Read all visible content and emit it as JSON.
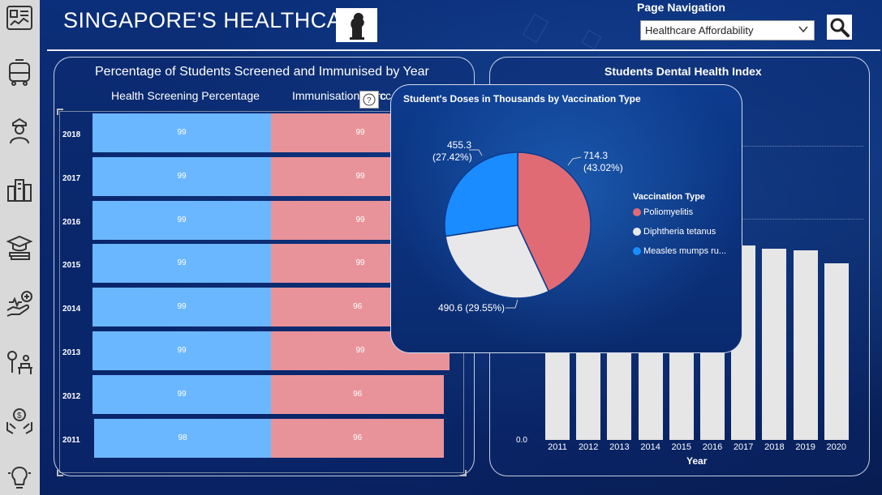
{
  "header": {
    "title": "SINGAPORE'S HEALTHCARE",
    "logo_icon": "merlion-icon"
  },
  "navigation": {
    "label": "Page Navigation",
    "selected": "Healthcare Affordability",
    "search_icon": "search-icon"
  },
  "sidebar": {
    "items": [
      {
        "icon": "dashboard-icon"
      },
      {
        "icon": "bus-icon"
      },
      {
        "icon": "officer-icon"
      },
      {
        "icon": "city-icon"
      },
      {
        "icon": "education-icon"
      },
      {
        "icon": "healthcare-hand-icon"
      },
      {
        "icon": "park-bench-icon"
      },
      {
        "icon": "money-hands-icon"
      },
      {
        "icon": "lightbulb-icon"
      }
    ]
  },
  "left_panel": {
    "title": "Percentage of Students Screened and Immunised by Year",
    "col1": "Health Screening Percentage",
    "col2": "Immunisation Perc",
    "col2_tail": "cc",
    "help_icon": "?"
  },
  "right_panel": {
    "title": "Students Dental Health Index",
    "xlabel": "Year",
    "y_zero": "0.0"
  },
  "popup": {
    "title": "Student's Doses in Thousands by Vaccination Type",
    "legend_title": "Vaccination Type",
    "labels": {
      "measles_value": "455.3",
      "measles_pct": "(27.42%)",
      "polio_value": "714.3",
      "polio_pct": "(43.02%)",
      "diph_label": "490.6 (29.55%)"
    }
  },
  "chart_data": [
    {
      "type": "bar",
      "title": "Percentage of Students Screened and Immunised by Year",
      "categories": [
        "2018",
        "2017",
        "2016",
        "2015",
        "2014",
        "2013",
        "2012",
        "2011"
      ],
      "series": [
        {
          "name": "Health Screening Percentage",
          "values": [
            99,
            99,
            99,
            99,
            99,
            99,
            99,
            98
          ],
          "color": "#6bb7ff"
        },
        {
          "name": "Immunisation Percentage",
          "values": [
            99,
            99,
            99,
            99,
            96,
            99,
            96,
            96
          ],
          "color": "#e8939a"
        }
      ]
    },
    {
      "type": "pie",
      "title": "Student's Doses in Thousands by Vaccination Type",
      "slices": [
        {
          "name": "Poliomyelitis",
          "value": 714.3,
          "percent": 43.02,
          "color": "#e06b75"
        },
        {
          "name": "Diphtheria tetanus",
          "value": 490.6,
          "percent": 29.55,
          "color": "#e8e8ea"
        },
        {
          "name": "Measles mumps ru...",
          "value": 455.3,
          "percent": 27.42,
          "color": "#1a8cff"
        }
      ]
    },
    {
      "type": "bar",
      "title": "Students Dental Health Index",
      "xlabel": "Year",
      "categories": [
        "2011",
        "2012",
        "2013",
        "2014",
        "2015",
        "2016",
        "2017",
        "2018",
        "2019",
        "2020"
      ],
      "values": [
        null,
        null,
        null,
        null,
        null,
        null,
        2.75,
        2.7,
        2.68,
        2.5
      ],
      "ylim": [
        0,
        4.5
      ],
      "color": "#e6e6e6"
    }
  ]
}
